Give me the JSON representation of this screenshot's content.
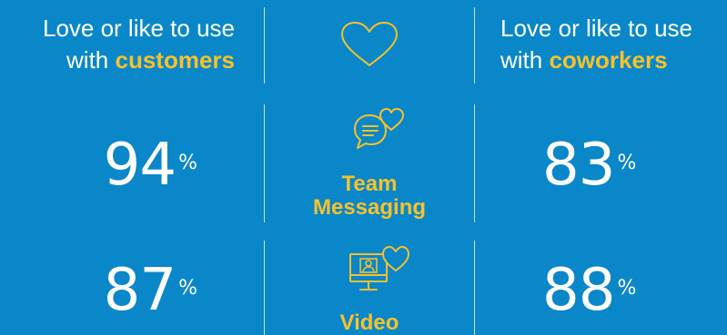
{
  "header": {
    "left": {
      "line1": "Love or like to use",
      "line2_prefix": "with ",
      "line2_highlight": "customers"
    },
    "right": {
      "line1": "Love or like to use",
      "line2_prefix": "with ",
      "line2_highlight": "coworkers"
    }
  },
  "rows": [
    {
      "label_line1": "Team",
      "label_line2": "Messaging",
      "customers_value": "94",
      "coworkers_value": "83",
      "unit": "%",
      "icon": "chat-bubbles-heart-icon"
    },
    {
      "label_line1": "Video",
      "label_line2": "",
      "customers_value": "87",
      "coworkers_value": "88",
      "unit": "%",
      "icon": "monitor-video-heart-icon"
    }
  ],
  "colors": {
    "background": "#0a87c8",
    "accent": "#f6c12d",
    "text": "#ffffff"
  }
}
